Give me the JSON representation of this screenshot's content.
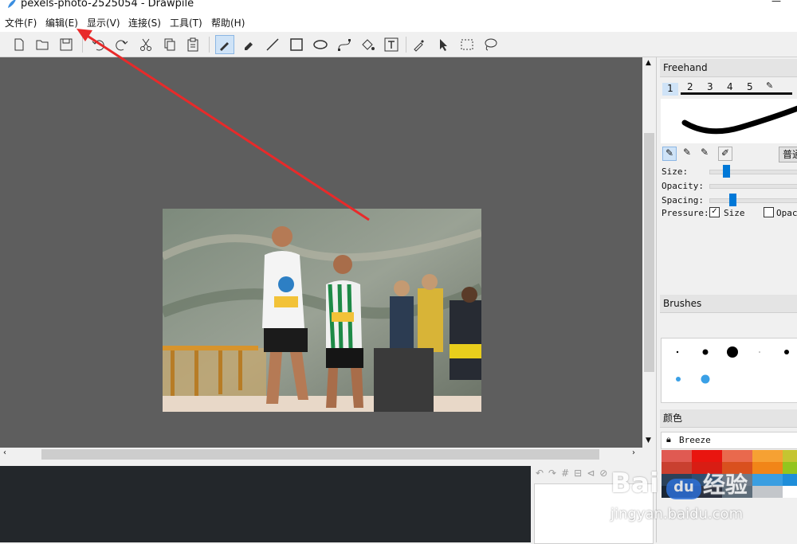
{
  "window": {
    "title": "pexels-photo-2525054 - Drawpile"
  },
  "menu": [
    "文件(F)",
    "编辑(E)",
    "显示(V)",
    "连接(S)",
    "工具(T)",
    "帮助(H)"
  ],
  "toolbar": {
    "icons": [
      "new-file-icon",
      "open-folder-icon",
      "save-icon",
      "undo-icon",
      "redo-icon",
      "cut-icon",
      "copy-icon",
      "paste-icon",
      "brush-icon",
      "eraser-icon",
      "line-icon",
      "rectangle-icon",
      "ellipse-icon",
      "bezier-icon",
      "fill-bucket-icon",
      "text-icon",
      "color-picker-icon",
      "select-arrow-icon",
      "rect-select-icon",
      "lasso-icon"
    ],
    "active": "brush-icon"
  },
  "freehand": {
    "title": "Freehand",
    "tabs": [
      "1",
      "2",
      "3",
      "4",
      "5"
    ],
    "mode_button": "普通",
    "size_label": "Size:",
    "opacity_label": "Opacity:",
    "spacing_label": "Spacing:",
    "pressure_label": "Pressure:",
    "pressure_size": "Size",
    "pressure_opacity": "Opac",
    "size_value": 0.14,
    "spacing_value": 0.22
  },
  "brushes": {
    "title": "Brushes"
  },
  "colors": {
    "title": "颜色",
    "palette_name": "Breeze",
    "swatches": [
      [
        "#e05a52",
        "#e9150f",
        "#e9694d",
        "#f6a133",
        "#c5c531"
      ],
      [
        "#c94030",
        "#d81d14",
        "#d9501e",
        "#f18518",
        "#93c51e"
      ],
      [
        "#2b4159",
        "#2e4f72",
        "#6e7a88",
        "#3a9ee1",
        "#1f8ed9"
      ],
      [
        "#1a2635",
        "#2c3240",
        "#5e6d7a",
        "#c3c6ca",
        "#ffffff"
      ]
    ]
  },
  "watermark": {
    "text": "Bai",
    "text2": "经验",
    "url": "jingyan.baidu.com",
    "du": "du"
  }
}
